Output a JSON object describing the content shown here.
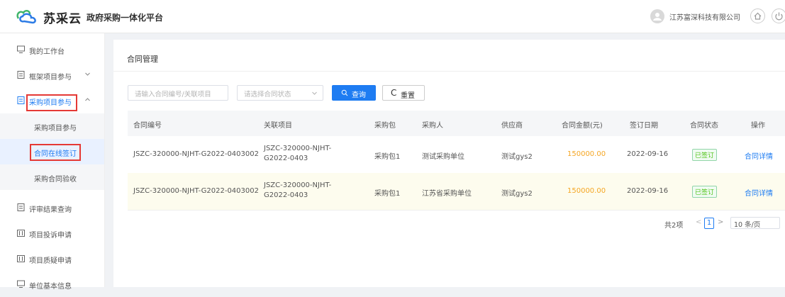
{
  "header": {
    "logo_text": "苏采云",
    "platform_title": "政府采购一体化平台",
    "company": "江苏富深科技有限公司",
    "colors": {
      "brand_green": "#3fb56a",
      "brand_blue": "#2c7be5"
    }
  },
  "sidebar": {
    "items": [
      {
        "label": "我的工作台",
        "icon": "monitor-icon"
      },
      {
        "label": "框架项目参与",
        "icon": "doc-icon",
        "chevron": "down"
      },
      {
        "label": "采购项目参与",
        "icon": "doc-icon",
        "chevron": "up",
        "active": true
      },
      {
        "label": "采购项目参与",
        "sub": true
      },
      {
        "label": "合同在线签订",
        "sub": true,
        "active": true
      },
      {
        "label": "采购合同验收",
        "sub": true
      },
      {
        "label": "评审结果查询",
        "icon": "doc-icon"
      },
      {
        "label": "项目投诉申请",
        "icon": "calendar-icon"
      },
      {
        "label": "项目质疑申请",
        "icon": "calendar-icon"
      },
      {
        "label": "单位基本信息",
        "icon": "monitor-icon"
      }
    ]
  },
  "main": {
    "title": "合同管理",
    "filters": {
      "contract_placeholder": "请输入合同编号/关联项目",
      "status_placeholder": "请选择合同状态",
      "search_label": "查询",
      "reset_label": "重置"
    },
    "table": {
      "headers": [
        "合同编号",
        "关联项目",
        "采购包",
        "采购人",
        "供应商",
        "合同金额(元)",
        "签订日期",
        "合同状态",
        "操作"
      ],
      "rows": [
        {
          "contract_no": "JSZC-320000-NJHT-G2022-0403002",
          "project": "JSZC-320000-NJHT-G2022-0403",
          "package": "采购包1",
          "purchaser": "测试采购单位",
          "supplier": "测试gys2",
          "amount": "150000.00",
          "date": "2022-09-16",
          "status": "已签订",
          "action": "合同详情"
        },
        {
          "contract_no": "JSZC-320000-NJHT-G2022-0403002",
          "project": "JSZC-320000-NJHT-G2022-0403",
          "package": "采购包1",
          "purchaser": "江苏省采购单位",
          "supplier": "测试gys2",
          "amount": "150000.00",
          "date": "2022-09-16",
          "status": "已签订",
          "action": "合同详情"
        }
      ]
    },
    "pagination": {
      "total": "共2项",
      "current_page": "1",
      "page_size": "10 条/页"
    }
  }
}
